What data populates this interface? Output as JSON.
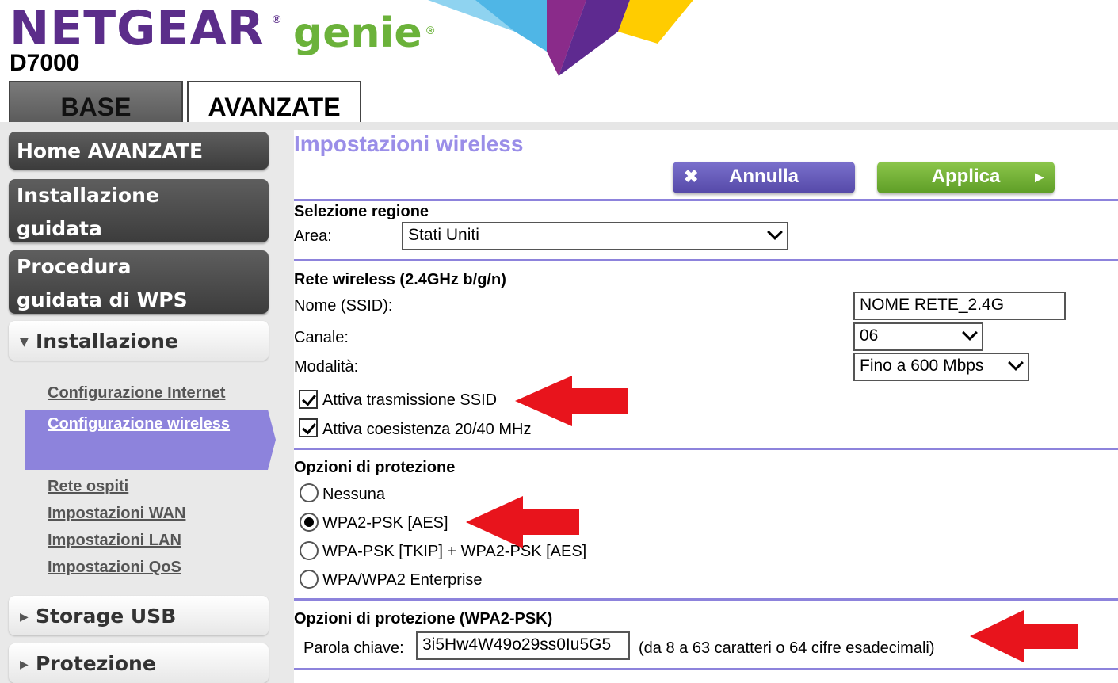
{
  "header": {
    "brand": "NETGEAR",
    "brand_reg": "®",
    "product": "genie",
    "product_reg": "®",
    "model": "D7000"
  },
  "tabs": [
    {
      "label": "BASE"
    },
    {
      "label": "AVANZATE"
    }
  ],
  "sidebar": {
    "home": "Home AVANZATE",
    "setup_wizard_l1": "Installazione",
    "setup_wizard_l2": "guidata",
    "wps_l1": "Procedura",
    "wps_l2": "guidata di WPS",
    "group_setup": "Installazione",
    "links": [
      "Configurazione Internet",
      "Configurazione wireless",
      "Rete ospiti",
      "Impostazioni WAN",
      "Impostazioni LAN",
      "Impostazioni QoS"
    ],
    "group_storage": "Storage USB",
    "group_security": "Protezione"
  },
  "main": {
    "title": "Impostazioni wireless",
    "cancel_label": "Annulla",
    "apply_label": "Applica",
    "region": {
      "heading": "Selezione regione",
      "area_label": "Area:",
      "area_value": "Stati Uniti"
    },
    "wireless": {
      "heading": "Rete wireless  (2.4GHz b/g/n)",
      "ssid_label": "Nome (SSID):",
      "ssid_value": "NOME RETE_2.4G",
      "channel_label": "Canale:",
      "channel_value": "06",
      "mode_label": "Modalità:",
      "mode_value": "Fino a 600 Mbps",
      "ssid_broadcast": "Attiva trasmissione SSID",
      "coexistence": "Attiva coesistenza 20/40 MHz"
    },
    "security": {
      "heading": "Opzioni di protezione",
      "options": [
        "Nessuna",
        "WPA2-PSK [AES]",
        "WPA-PSK [TKIP] + WPA2-PSK [AES]",
        "WPA/WPA2 Enterprise"
      ],
      "selected": "WPA2-PSK [AES]"
    },
    "psk": {
      "heading": "Opzioni di protezione (WPA2-PSK)",
      "key_label": "Parola chiave:",
      "key_value": "3i5Hw4W49o29ss0Iu5G5",
      "hint": "(da 8 a 63 caratteri o 64 cifre esadecimali)"
    }
  },
  "colors": {
    "brand_purple": "#5b2d8a",
    "brand_green": "#6bb23a",
    "accent_lilac": "#8d83dc",
    "arrow_red": "#e8141c"
  }
}
